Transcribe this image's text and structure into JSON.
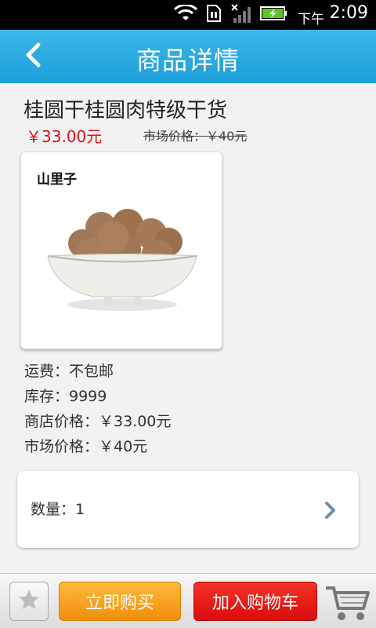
{
  "status_bar": {
    "time_prefix": "下午",
    "time": "2:09"
  },
  "header": {
    "title": "商品详情"
  },
  "product": {
    "name": "桂圆干桂圆肉特级干货",
    "price": "￥33.00元",
    "market_price_top": "市场价格：￥40元",
    "brand_text": "山里子"
  },
  "details": {
    "shipping": "运费：不包邮",
    "stock": "库存：9999",
    "store_price": "商店价格：￥33.00元",
    "market_price": "市场价格：￥40元"
  },
  "quantity": {
    "label": "数量：1"
  },
  "bottom_bar": {
    "buy_now_label": "立即购买",
    "add_to_cart_label": "加入购物车"
  },
  "colors": {
    "header_blue": "#1c9fd8",
    "price_red": "#e0101b",
    "buy_orange": "#f08f09",
    "cart_red": "#d90c0c"
  },
  "icons": [
    "wifi-icon",
    "sim-icon",
    "signal-icon",
    "battery-icon",
    "back-arrow-icon",
    "chevron-right-icon",
    "star-icon",
    "shopping-cart-icon"
  ]
}
